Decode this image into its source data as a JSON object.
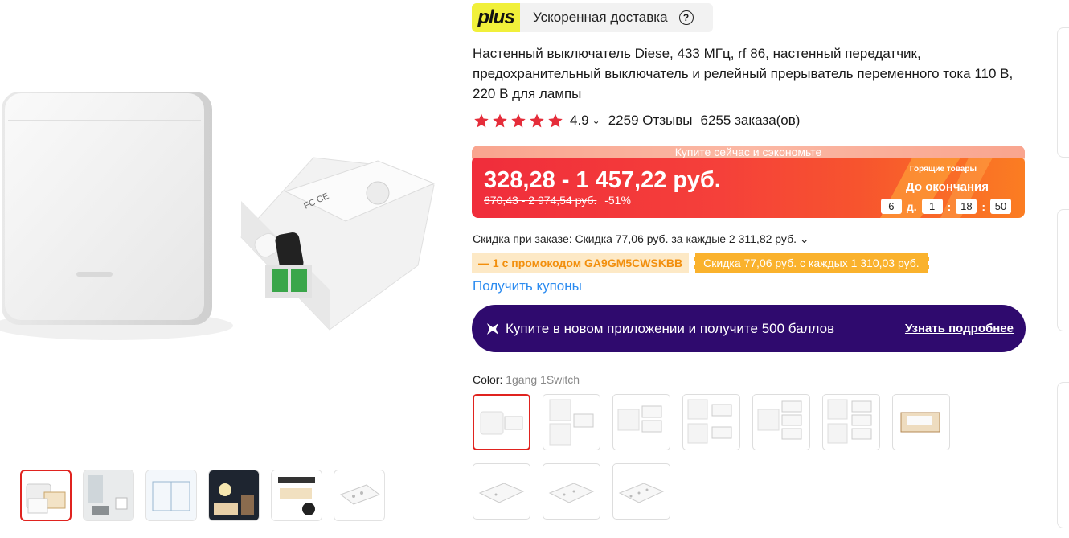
{
  "plus": {
    "logo": "plus",
    "label": "Ускоренная доставка",
    "help_icon": "question-circle-icon"
  },
  "product": {
    "title": "Настенный выключатель Diese, 433 МГц, rf 86, настенный передатчик, предохранительный выключатель и релейный прерыватель переменного тока 110 В, 220 В для лампы"
  },
  "rating": {
    "stars": 5,
    "score": "4.9",
    "reviews": "2259 Отзывы",
    "orders": "6255 заказа(ов)"
  },
  "price": {
    "banner_top": "Купите сейчас и сэкономьте",
    "current": "328,28 - 1 457,22 руб.",
    "old": "670,43 - 2 974,54 руб.",
    "discount": "-51%",
    "hot_label": "Горящие товары",
    "deadline_label": "До окончания",
    "timer": {
      "days": "6",
      "days_unit": "д.",
      "hours": "1",
      "minutes": "18",
      "seconds": "50"
    }
  },
  "discount_line": "Скидка при заказе: Скидка 77,06 руб. за каждые 2 311,82 руб.",
  "promo": {
    "code_text": "— 1 с промокодом GA9GM5CWSKBB",
    "discount_text": "Скидка 77,06 руб. с каждых 1 310,03 руб."
  },
  "coupons_link": "Получить купоны",
  "app_banner": {
    "text": "Купите в новом приложении и получите 500 баллов",
    "link": "Узнать подробнее"
  },
  "color": {
    "label": "Color: ",
    "value": "1gang 1Switch",
    "options_count": 10,
    "selected_index": 0
  },
  "gallery": {
    "thumbnails": 6,
    "selected_index": 0
  },
  "colors": {
    "accent_red": "#e0231f",
    "price_red": "#f02d3b",
    "coupon_blue": "#2d8cf0",
    "app_purple": "#2f0a6e",
    "plus_yellow": "#f1f03a"
  }
}
